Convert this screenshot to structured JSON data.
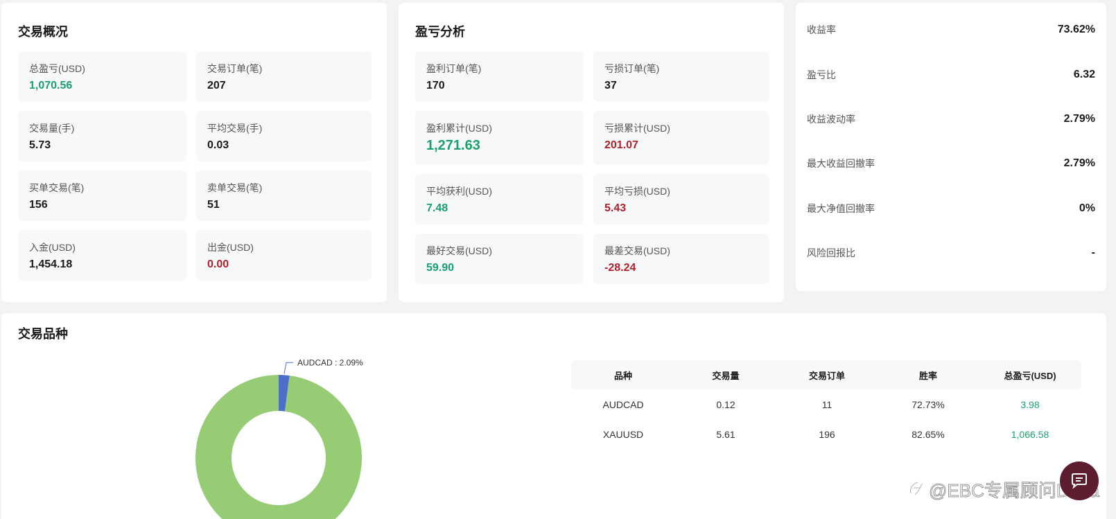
{
  "overview": {
    "title": "交易概况",
    "items": [
      {
        "label": "总盈亏(USD)",
        "value": "1,070.56",
        "tone": "green"
      },
      {
        "label": "交易订单(笔)",
        "value": "207",
        "tone": ""
      },
      {
        "label": "交易量(手)",
        "value": "5.73",
        "tone": ""
      },
      {
        "label": "平均交易(手)",
        "value": "0.03",
        "tone": ""
      },
      {
        "label": "买单交易(笔)",
        "value": "156",
        "tone": ""
      },
      {
        "label": "卖单交易(笔)",
        "value": "51",
        "tone": ""
      },
      {
        "label": "入金(USD)",
        "value": "1,454.18",
        "tone": ""
      },
      {
        "label": "出金(USD)",
        "value": "0.00",
        "tone": "red"
      }
    ]
  },
  "profit_loss": {
    "title": "盈亏分析",
    "items": [
      {
        "label": "盈利订单(笔)",
        "value": "170",
        "tone": ""
      },
      {
        "label": "亏损订单(笔)",
        "value": "37",
        "tone": ""
      },
      {
        "label": "盈利累计(USD)",
        "value": "1,271.63",
        "tone": "green"
      },
      {
        "label": "亏损累计(USD)",
        "value": "201.07",
        "tone": "red"
      },
      {
        "label": "平均获利(USD)",
        "value": "7.48",
        "tone": "green"
      },
      {
        "label": "平均亏损(USD)",
        "value": "5.43",
        "tone": "red"
      },
      {
        "label": "最好交易(USD)",
        "value": "59.90",
        "tone": "green"
      },
      {
        "label": "最差交易(USD)",
        "value": "-28.24",
        "tone": "red"
      }
    ]
  },
  "ratios": {
    "items": [
      {
        "label": "收益率",
        "value": "73.62%"
      },
      {
        "label": "盈亏比",
        "value": "6.32"
      },
      {
        "label": "收益波动率",
        "value": "2.79%"
      },
      {
        "label": "最大收益回撤率",
        "value": "2.79%"
      },
      {
        "label": "最大净值回撤率",
        "value": "0%"
      },
      {
        "label": "风险回报比",
        "value": "-"
      }
    ]
  },
  "symbols": {
    "title": "交易品种",
    "table": {
      "headers": [
        "品种",
        "交易量",
        "交易订单",
        "胜率",
        "总盈亏(USD)"
      ],
      "rows": [
        [
          "AUDCAD",
          "0.12",
          "11",
          "72.73%",
          "3.98"
        ],
        [
          "XAUUSD",
          "5.61",
          "196",
          "82.65%",
          "1,066.58"
        ]
      ]
    }
  },
  "chart_data": {
    "type": "pie",
    "donut": true,
    "slices": [
      {
        "name": "AUDCAD",
        "value": 2.09,
        "label": "AUDCAD : 2.09%",
        "color": "#4e6fc8"
      },
      {
        "name": "XAUUSD",
        "value": 97.91,
        "label": "",
        "color": "#95cc74"
      }
    ]
  },
  "colors": {
    "profit": "#1aa06d",
    "loss": "#b1202a",
    "fab": "#5c1e2e"
  },
  "fab": {
    "icon": "chat-icon"
  },
  "watermark": {
    "text": "@EBC专属顾问Dana",
    "icon": "brand-logo-icon"
  }
}
